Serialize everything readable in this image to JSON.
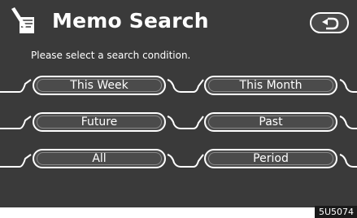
{
  "header": {
    "title": "Memo Search",
    "prompt": "Please select a search condition."
  },
  "options": [
    {
      "label": "This Week"
    },
    {
      "label": "This Month"
    },
    {
      "label": "Future"
    },
    {
      "label": "Past"
    },
    {
      "label": "All"
    },
    {
      "label": "Period"
    }
  ],
  "figure_code": "5U5074",
  "icons": {
    "title_icon": "memo-pen-icon",
    "back_icon": "back-arrow-icon"
  },
  "colors": {
    "background": "#3a3a3a",
    "foreground": "#ffffff"
  }
}
